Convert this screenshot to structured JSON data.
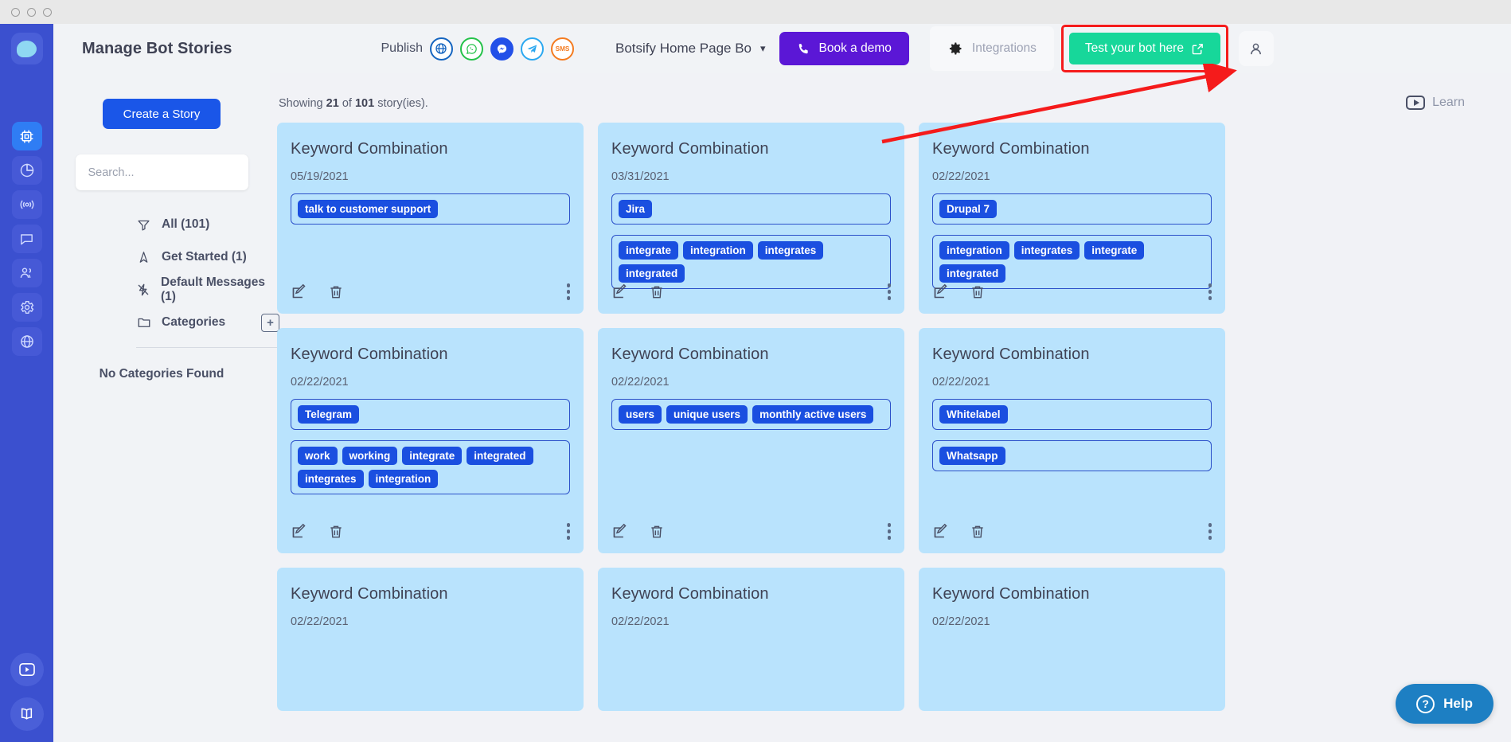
{
  "titlebar": {
    "dots": 3
  },
  "rail": {
    "logo": "botsify-logo",
    "items": [
      {
        "name": "bot-stories",
        "icon": "chip-icon",
        "active": true
      },
      {
        "name": "analytics",
        "icon": "pie-chart-icon",
        "active": false
      },
      {
        "name": "broadcast",
        "icon": "broadcast-icon",
        "active": false
      },
      {
        "name": "livechat",
        "icon": "chat-bubble-icon",
        "active": false
      },
      {
        "name": "users",
        "icon": "users-icon",
        "active": false
      },
      {
        "name": "settings",
        "icon": "gear-icon",
        "active": false
      },
      {
        "name": "website",
        "icon": "globe-icon",
        "active": false
      }
    ],
    "bottom": [
      {
        "name": "video-tutorials",
        "icon": "play-icon"
      },
      {
        "name": "documentation",
        "icon": "book-icon"
      }
    ]
  },
  "header": {
    "title": "Manage Bot Stories",
    "publish_label": "Publish",
    "publish_channels": [
      {
        "name": "web-channel",
        "glyph": "⊕",
        "key": "globe"
      },
      {
        "name": "whatsapp-channel",
        "glyph": "✆",
        "key": "whatsapp"
      },
      {
        "name": "messenger-channel",
        "glyph": "⚡",
        "key": "messenger"
      },
      {
        "name": "telegram-channel",
        "glyph": "➤",
        "key": "telegram"
      },
      {
        "name": "sms-channel",
        "glyph": "SMS",
        "key": "sms"
      }
    ],
    "bot_name": "Botsify Home Page Bo",
    "book_demo": "Book a demo",
    "integrations": "Integrations",
    "test_bot": "Test your bot here",
    "highlight_color": "#f51b1b",
    "test_btn_color": "#17d79a",
    "demo_btn_color": "#5b17d6"
  },
  "sidebar": {
    "create_story": "Create a Story",
    "search_placeholder": "Search...",
    "search_value": "",
    "filters": [
      {
        "label": "All (101)",
        "icon": "filter-icon"
      },
      {
        "label": "Get Started (1)",
        "icon": "rocket-icon"
      },
      {
        "label": "Default Messages (1)",
        "icon": "flash-off-icon"
      },
      {
        "label": "Categories",
        "icon": "folder-icon"
      }
    ],
    "add_category": "+",
    "no_categories": "No Categories Found"
  },
  "main": {
    "showing_prefix": "Showing",
    "showing_count": "21",
    "showing_mid": "of",
    "showing_total": "101",
    "showing_suffix": "story(ies).",
    "learn": "Learn",
    "help": "Help",
    "cards": [
      {
        "title": "Keyword Combination",
        "date": "05/19/2021",
        "groups": [
          [
            "talk to customer support"
          ]
        ]
      },
      {
        "title": "Keyword Combination",
        "date": "03/31/2021",
        "groups": [
          [
            "Jira"
          ],
          [
            "integrate",
            "integration",
            "integrates",
            "integrated"
          ]
        ]
      },
      {
        "title": "Keyword Combination",
        "date": "02/22/2021",
        "groups": [
          [
            "Drupal 7"
          ],
          [
            "integration",
            "integrates",
            "integrate",
            "integrated"
          ]
        ]
      },
      {
        "title": "Keyword Combination",
        "date": "02/22/2021",
        "groups": [
          [
            "Telegram"
          ],
          [
            "work",
            "working",
            "integrate",
            "integrated",
            "integrates",
            "integration"
          ]
        ]
      },
      {
        "title": "Keyword Combination",
        "date": "02/22/2021",
        "groups": [
          [
            "users",
            "unique users",
            "monthly active users"
          ]
        ]
      },
      {
        "title": "Keyword Combination",
        "date": "02/22/2021",
        "groups": [
          [
            "Whitelabel"
          ],
          [
            "Whatsapp"
          ]
        ]
      },
      {
        "title": "Keyword Combination",
        "date": "02/22/2021",
        "groups": []
      },
      {
        "title": "Keyword Combination",
        "date": "02/22/2021",
        "groups": []
      },
      {
        "title": "Keyword Combination",
        "date": "02/22/2021",
        "groups": []
      }
    ],
    "card_actions": {
      "edit": "edit-icon",
      "delete": "trash-icon",
      "more": "more-vertical-icon"
    }
  }
}
